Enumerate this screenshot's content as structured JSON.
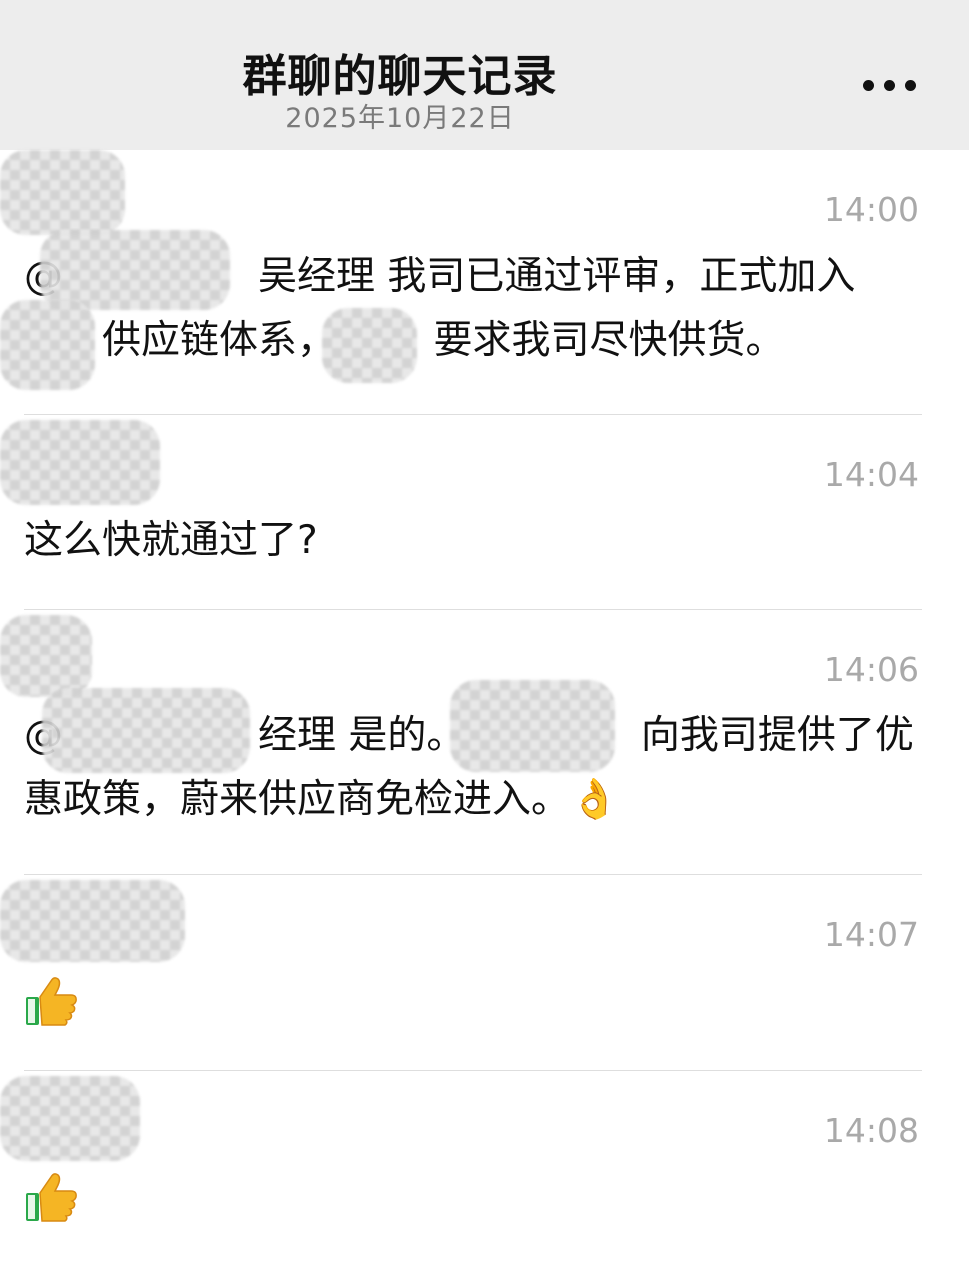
{
  "header": {
    "title": "群聊的聊天记录",
    "date": "2025年10月22日",
    "more_icon": "more-dots-icon"
  },
  "messages": [
    {
      "time": "14:00",
      "text": "@　　　　　吴经理 我司已通过评审，正式加入\n　　供应链体系，　　　要求我司尽快供货。"
    },
    {
      "time": "14:04",
      "text": "这么快就通过了?"
    },
    {
      "time": "14:06",
      "text": "@　　　　　经理 是的。　　　　　向我司提供了优\n惠政策，蔚来供应商免检进入。👌"
    },
    {
      "time": "14:07",
      "text": "",
      "emoji": "thumbs-up-icon"
    },
    {
      "time": "14:08",
      "text": "",
      "emoji": "thumbs-up-icon"
    }
  ],
  "colors": {
    "header_bg": "#ededed",
    "time_text": "#a9a9a9",
    "body_text": "#111111"
  }
}
